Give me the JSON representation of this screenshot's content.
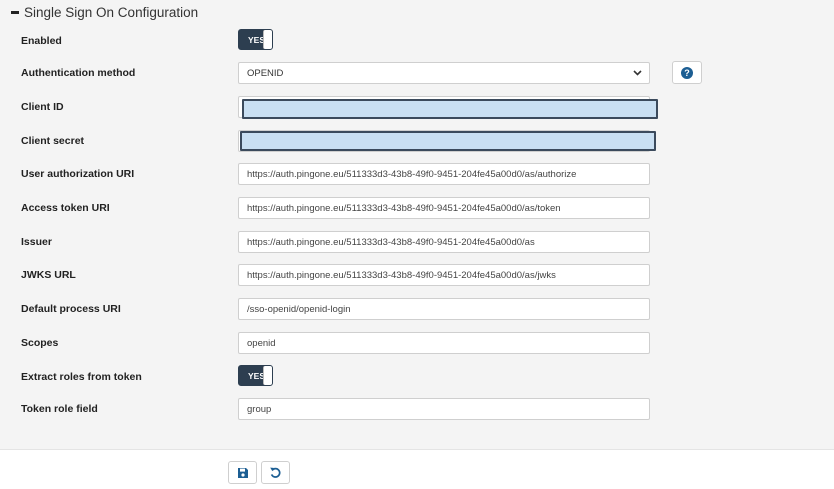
{
  "section": {
    "title": "Single Sign On Configuration"
  },
  "fields": {
    "enabled": {
      "label": "Enabled",
      "toggle_text": "YES"
    },
    "auth_method": {
      "label": "Authentication method",
      "value": "OPENID",
      "help_text": "?"
    },
    "client_id": {
      "label": "Client ID",
      "value": ""
    },
    "client_secret": {
      "label": "Client secret",
      "value": ""
    },
    "user_auth_uri": {
      "label": "User authorization URI",
      "value": "https://auth.pingone.eu/511333d3-43b8-49f0-9451-204fe45a00d0/as/authorize"
    },
    "access_token_uri": {
      "label": "Access token URI",
      "value": "https://auth.pingone.eu/511333d3-43b8-49f0-9451-204fe45a00d0/as/token"
    },
    "issuer": {
      "label": "Issuer",
      "value": "https://auth.pingone.eu/511333d3-43b8-49f0-9451-204fe45a00d0/as"
    },
    "jwks_url": {
      "label": "JWKS URL",
      "value": "https://auth.pingone.eu/511333d3-43b8-49f0-9451-204fe45a00d0/as/jwks"
    },
    "default_process_uri": {
      "label": "Default process URI",
      "value": "/sso-openid/openid-login"
    },
    "scopes": {
      "label": "Scopes",
      "value": "openid"
    },
    "extract_roles": {
      "label": "Extract roles from token",
      "toggle_text": "YES"
    },
    "token_role_field": {
      "label": "Token role field",
      "value": "group"
    }
  },
  "colors": {
    "toggle_bg": "#2d3e50",
    "accent": "#1c5e93",
    "highlight": "#c9dff2"
  },
  "icons": {
    "section": "minus-icon",
    "select": "chevron-down-icon",
    "help": "question-circle-icon",
    "save": "floppy-disk-icon",
    "reset": "undo-icon"
  }
}
